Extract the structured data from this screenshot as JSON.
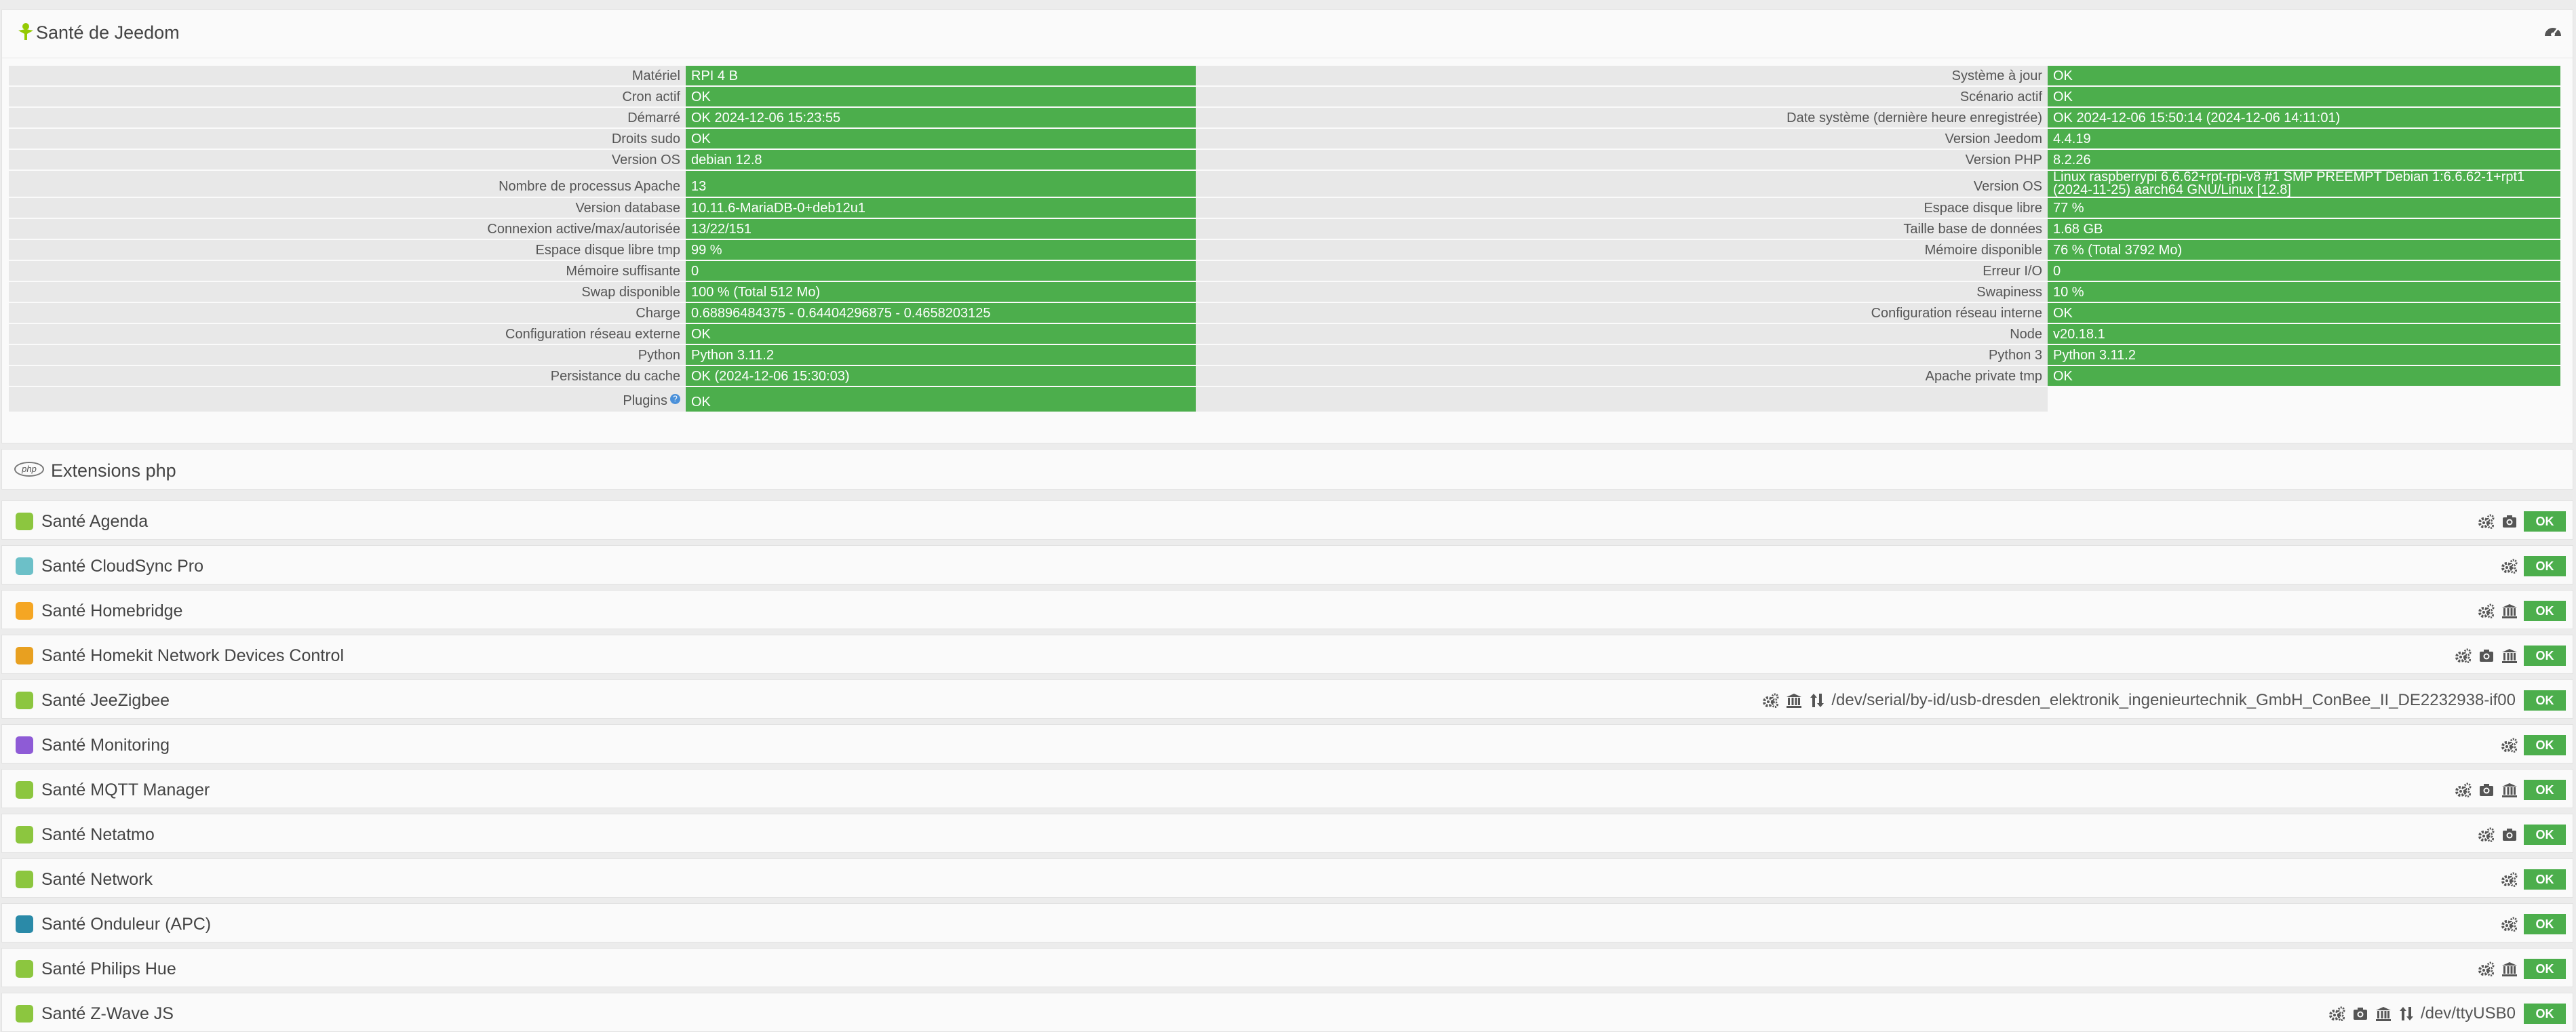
{
  "health": {
    "title": "Santé de Jeedom",
    "rows": [
      {
        "l1": "Matériel",
        "v1": "RPI 4 B",
        "l2": "Système à jour",
        "v2": "OK"
      },
      {
        "l1": "Cron actif",
        "v1": "OK",
        "l2": "Scénario actif",
        "v2": "OK"
      },
      {
        "l1": "Démarré",
        "v1": "OK 2024-12-06 15:23:55",
        "l2": "Date système (dernière heure enregistrée)",
        "v2": "OK 2024-12-06 15:50:14 (2024-12-06 14:11:01)"
      },
      {
        "l1": "Droits sudo",
        "v1": "OK",
        "l2": "Version Jeedom",
        "v2": "4.4.19"
      },
      {
        "l1": "Version OS",
        "v1": "debian 12.8",
        "l2": "Version PHP",
        "v2": "8.2.26"
      },
      {
        "l1": "Nombre de processus Apache",
        "v1": "13",
        "l2": "Version OS",
        "v2": "Linux raspberrypi 6.6.62+rpt-rpi-v8 #1 SMP PREEMPT Debian 1:6.6.62-1+rpt1 (2024-11-25) aarch64 GNU/Linux [12.8]"
      },
      {
        "l1": "Version database",
        "v1": "10.11.6-MariaDB-0+deb12u1",
        "l2": "Espace disque libre",
        "v2": "77 %"
      },
      {
        "l1": "Connexion active/max/autorisée",
        "v1": "13/22/151",
        "l2": "Taille base de données",
        "v2": "1.68 GB"
      },
      {
        "l1": "Espace disque libre tmp",
        "v1": "99 %",
        "l2": "Mémoire disponible",
        "v2": "76 % (Total 3792 Mo)"
      },
      {
        "l1": "Mémoire suffisante",
        "v1": "0",
        "l2": "Erreur I/O",
        "v2": "0"
      },
      {
        "l1": "Swap disponible",
        "v1": "100 % (Total 512 Mo)",
        "l2": "Swapiness",
        "v2": "10 %"
      },
      {
        "l1": "Charge",
        "v1": "0.68896484375 - 0.64404296875 - 0.4658203125",
        "l2": "Configuration réseau interne",
        "v2": "OK"
      },
      {
        "l1": "Configuration réseau externe",
        "v1": "OK",
        "l2": "Node",
        "v2": "v20.18.1"
      },
      {
        "l1": "Python",
        "v1": "Python 3.11.2",
        "l2": "Python 3",
        "v2": "Python 3.11.2"
      },
      {
        "l1": "Persistance du cache",
        "v1": "OK (2024-12-06 15:30:03)",
        "l2": "Apache private tmp",
        "v2": "OK"
      }
    ],
    "plugins_label": "Plugins",
    "plugins_value": "OK",
    "help_glyph": "?"
  },
  "php_section": {
    "title": "Extensions php",
    "icon_text": "php"
  },
  "plugins": [
    {
      "name": "Santé Agenda",
      "color": "#8cc63f",
      "icons": [
        "cogs",
        "camera"
      ],
      "port": "",
      "status": "OK"
    },
    {
      "name": "Santé CloudSync Pro",
      "color": "#6cc0c8",
      "icons": [
        "cogs"
      ],
      "port": "",
      "status": "OK"
    },
    {
      "name": "Santé Homebridge",
      "color": "#f5a623",
      "icons": [
        "cogs",
        "bank"
      ],
      "port": "",
      "status": "OK"
    },
    {
      "name": "Santé Homekit Network Devices Control",
      "color": "#e8a020",
      "icons": [
        "cogs",
        "camera",
        "bank"
      ],
      "port": "",
      "status": "OK"
    },
    {
      "name": "Santé JeeZigbee",
      "color": "#8cc63f",
      "icons": [
        "cogs",
        "bank",
        "arrows"
      ],
      "port": "/dev/serial/by-id/usb-dresden_elektronik_ingenieurtechnik_GmbH_ConBee_II_DE2232938-if00",
      "status": "OK"
    },
    {
      "name": "Santé Monitoring",
      "color": "#8e5bd6",
      "icons": [
        "cogs"
      ],
      "port": "",
      "status": "OK"
    },
    {
      "name": "Santé MQTT Manager",
      "color": "#8cc63f",
      "icons": [
        "cogs",
        "camera",
        "bank"
      ],
      "port": "",
      "status": "OK"
    },
    {
      "name": "Santé Netatmo",
      "color": "#8cc63f",
      "icons": [
        "cogs",
        "camera"
      ],
      "port": "",
      "status": "OK"
    },
    {
      "name": "Santé Network",
      "color": "#8cc63f",
      "icons": [
        "cogs"
      ],
      "port": "",
      "status": "OK"
    },
    {
      "name": "Santé Onduleur (APC)",
      "color": "#2a8aa8",
      "icons": [
        "cogs"
      ],
      "port": "",
      "status": "OK"
    },
    {
      "name": "Santé Philips Hue",
      "color": "#8cc63f",
      "icons": [
        "cogs",
        "bank"
      ],
      "port": "",
      "status": "OK"
    },
    {
      "name": "Santé Z-Wave JS",
      "color": "#8cc63f",
      "icons": [
        "cogs",
        "camera",
        "bank",
        "arrows"
      ],
      "port": "/dev/ttyUSB0",
      "status": "OK"
    }
  ]
}
